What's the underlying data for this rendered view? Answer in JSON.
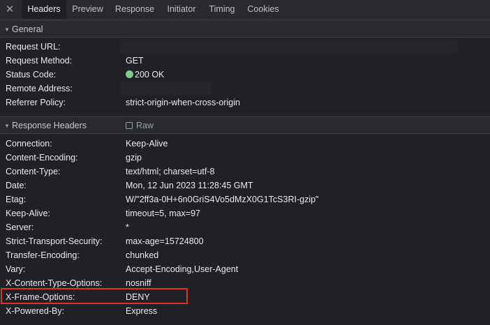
{
  "tabs": {
    "close_glyph": "✕",
    "items": [
      "Headers",
      "Preview",
      "Response",
      "Initiator",
      "Timing",
      "Cookies"
    ],
    "active": "Headers"
  },
  "general": {
    "title": "General",
    "rows": [
      {
        "key": "Request URL:",
        "value": ""
      },
      {
        "key": "Request Method:",
        "value": "GET"
      },
      {
        "key": "Status Code:",
        "value": "200 OK"
      },
      {
        "key": "Remote Address:",
        "value": ""
      },
      {
        "key": "Referrer Policy:",
        "value": "strict-origin-when-cross-origin"
      }
    ]
  },
  "response_headers": {
    "title": "Response Headers",
    "raw_label": "Raw",
    "raw_checked": false,
    "rows": [
      {
        "key": "Connection:",
        "value": "Keep-Alive"
      },
      {
        "key": "Content-Encoding:",
        "value": "gzip"
      },
      {
        "key": "Content-Type:",
        "value": "text/html; charset=utf-8"
      },
      {
        "key": "Date:",
        "value": "Mon, 12 Jun 2023 11:28:45 GMT"
      },
      {
        "key": "Etag:",
        "value": "W/\"2ff3a-0H+6n0GriS4Vo5dMzX0G1TcS3RI-gzip\""
      },
      {
        "key": "Keep-Alive:",
        "value": "timeout=5, max=97"
      },
      {
        "key": "Server:",
        "value": "*"
      },
      {
        "key": "Strict-Transport-Security:",
        "value": "max-age=15724800"
      },
      {
        "key": "Transfer-Encoding:",
        "value": "chunked"
      },
      {
        "key": "Vary:",
        "value": "Accept-Encoding,User-Agent"
      },
      {
        "key": "X-Content-Type-Options:",
        "value": "nosniff"
      },
      {
        "key": "X-Frame-Options:",
        "value": "DENY"
      },
      {
        "key": "X-Powered-By:",
        "value": "Express"
      }
    ]
  },
  "colors": {
    "status_ok": "#81c995",
    "highlight": "#e8321e",
    "background": "#202124"
  }
}
